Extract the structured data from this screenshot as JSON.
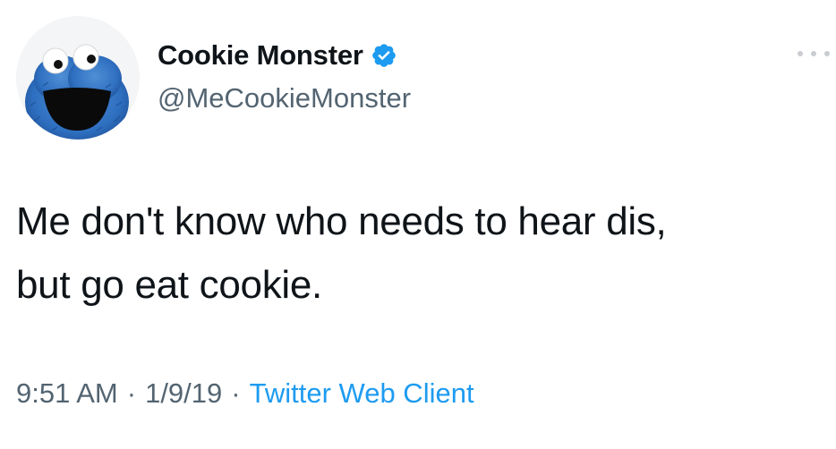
{
  "user": {
    "display_name": "Cookie Monster",
    "handle": "@MeCookieMonster",
    "verified_icon": "verified-badge-icon",
    "avatar_icon": "cookie-monster-avatar"
  },
  "tweet": {
    "text_line_1": "Me don't know who needs to hear dis,",
    "text_line_2": "but go eat cookie."
  },
  "meta": {
    "time": "9:51 AM",
    "separator_1": "·",
    "date": "1/9/19",
    "separator_2": "·",
    "source": "Twitter Web Client"
  },
  "colors": {
    "text_primary": "#0f1419",
    "text_secondary": "#536471",
    "accent": "#1d9bf0",
    "verified": "#1d9bf0",
    "more_dots": "#c9ccd0"
  },
  "icons": {
    "more": "more-options-icon"
  }
}
